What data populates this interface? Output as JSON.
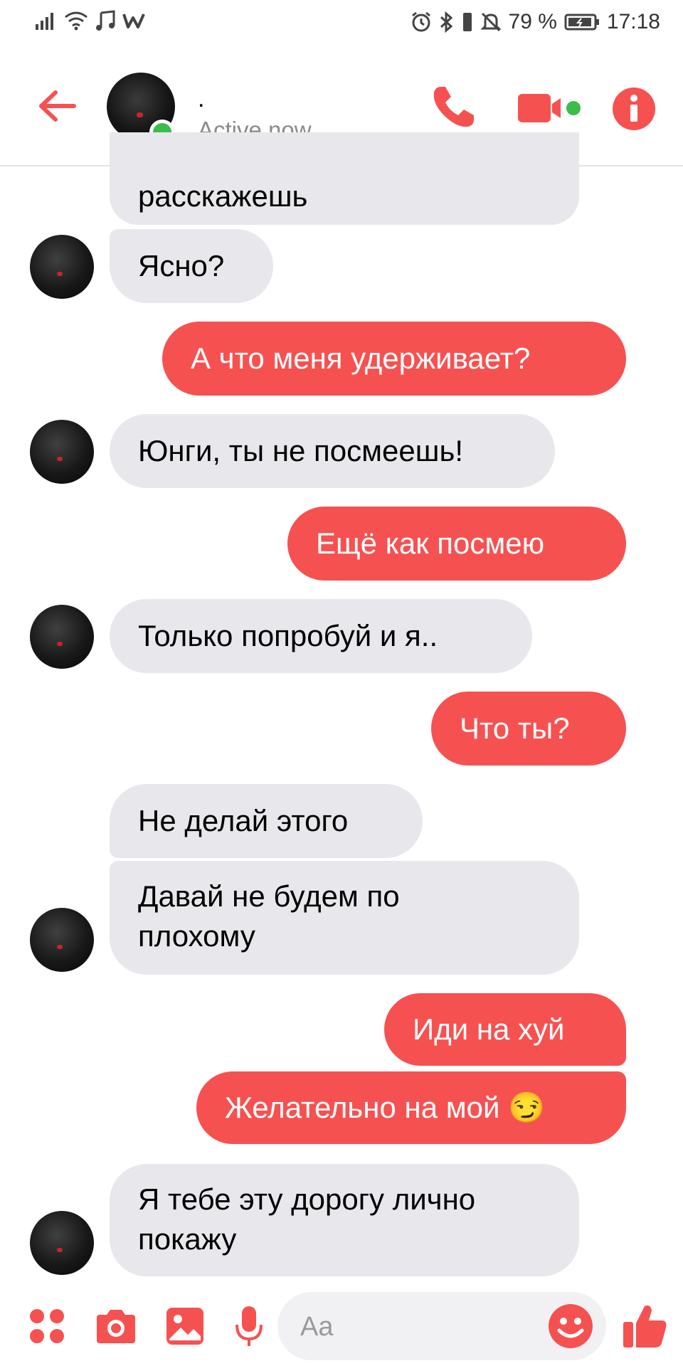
{
  "status_bar": {
    "battery": "79 %",
    "time": "17:18"
  },
  "header": {
    "contact_name": ".",
    "active_status": "Active now"
  },
  "messages": [
    {
      "side": "in",
      "text": "расскажешь"
    },
    {
      "side": "in",
      "text": "Ясно?"
    },
    {
      "side": "out",
      "text": "А что меня удерживает?"
    },
    {
      "side": "in",
      "text": "Юнги, ты не посмеешь!"
    },
    {
      "side": "out",
      "text": "Ещё как посмею"
    },
    {
      "side": "in",
      "text": "Только попробуй и я.."
    },
    {
      "side": "out",
      "text": "Что ты?"
    },
    {
      "side": "in",
      "text": "Не делай этого"
    },
    {
      "side": "in",
      "text": "Давай не будем по\nплохому"
    },
    {
      "side": "out",
      "text": "Иди на хуй"
    },
    {
      "side": "out",
      "text": "Желательно на мой 😏"
    },
    {
      "side": "in",
      "text": "Я тебе эту дорогу лично\nпокажу"
    }
  ],
  "composer": {
    "placeholder": "Aa"
  },
  "colors": {
    "accent": "#f65151",
    "incoming_bubble": "#e8e7ec",
    "online": "#3bbd4a"
  },
  "icons": [
    "back-arrow-icon",
    "phone-icon",
    "video-camera-icon",
    "info-icon",
    "menu-dots-icon",
    "camera-icon",
    "image-icon",
    "microphone-icon",
    "emoji-icon",
    "thumbs-up-icon"
  ]
}
